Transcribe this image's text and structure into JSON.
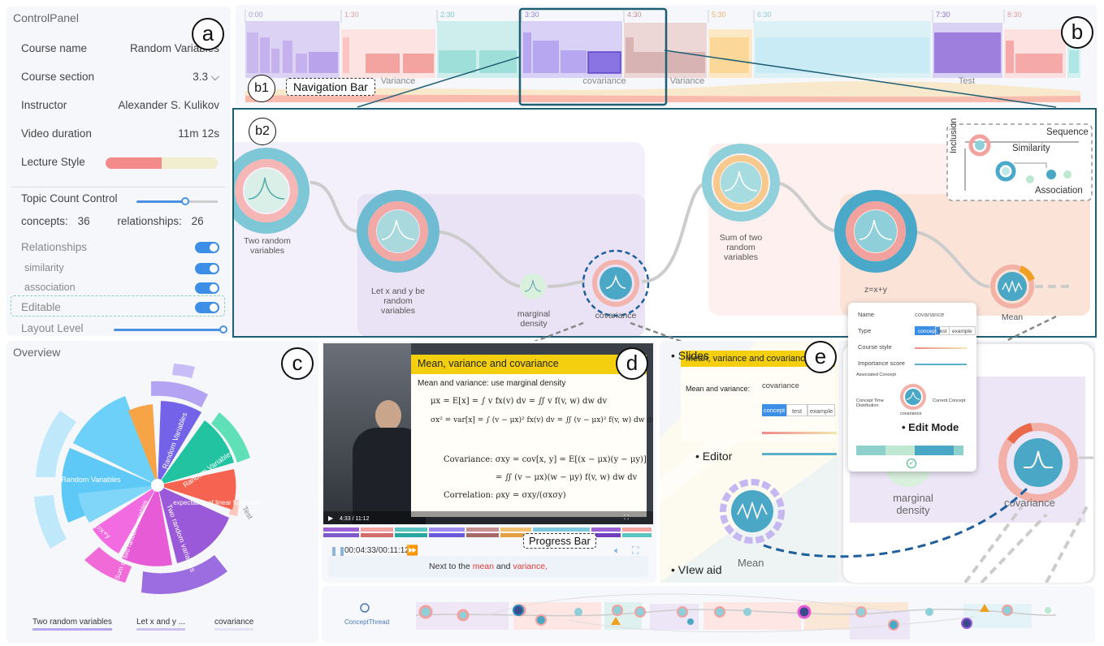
{
  "control_panel": {
    "title": "ControlPanel",
    "course_name_label": "Course name",
    "course_name_value": "Random Variables",
    "course_section_label": "Course section",
    "course_section_value": "3.3",
    "instructor_label": "Instructor",
    "instructor_value": "Alexander S. Kulikov",
    "duration_label": "Video duration",
    "duration_value": "11m 12s",
    "lecture_style_label": "Lecture Style",
    "topic_count_label": "Topic Count Control",
    "concepts_label": "concepts:",
    "concepts_value": "36",
    "relationships_count_label": "relationships:",
    "relationships_count_value": "26",
    "relationships_label": "Relationships",
    "similarity_label": "similarity",
    "association_label": "association",
    "editable_label": "Editable",
    "layout_label": "Layout Level"
  },
  "badges": {
    "a": "a",
    "b": "b",
    "b1": "b1",
    "b2": "b2",
    "c": "c",
    "d": "d",
    "e": "e"
  },
  "navbar": {
    "ticks": [
      "0:00",
      "1:30",
      "2:30",
      "3:30",
      "4:30",
      "5:30",
      "6:30",
      "7:30",
      "8:30"
    ],
    "labels": [
      "Variance",
      "covariance",
      "Variance",
      "Test"
    ],
    "navigation_label": "Navigation Bar"
  },
  "graph": {
    "nodes": [
      "Two random variables",
      "Let x and y be random variables",
      "marginal density",
      "covariance",
      "Sum of two random variables",
      "z=x+y",
      "Mean"
    ],
    "legend": {
      "sequence": "Sequence",
      "similarity": "Similarity",
      "inclusion": "Inclusion",
      "association": "Association"
    }
  },
  "overview": {
    "title": "Overview",
    "segments": [
      "Random Variables",
      "Random Variables",
      "Random Variables",
      "expectation of linear functions",
      "Test",
      "Two random variables",
      "Sum of two random variables",
      "z=x+y"
    ],
    "breadcrumbs": [
      "Two random variables",
      "Let x and y ...",
      "covariance"
    ]
  },
  "video": {
    "slide_title": "Mean, variance and covariance",
    "slide_subtitle": "Mean and variance: use marginal density",
    "formula1": "μx = E[x] = ∫ v fx(v) dv = ∬ v f(v, w) dw dv",
    "formula2": "σx² = var[x] = ∫ (v − μx)² fx(v) dv = ∬ (v − μx)² f(v, w) dw dv",
    "formula3": "Covariance: σxy = cov[x, y] = E[(x − μx)(y − μy)]",
    "formula4": "= ∬ (v − μx)(w − μy) f(v, w) dw dv",
    "formula5": "Correlation: ρxy = σxy/(σxσy)",
    "time_small": "4:33 / 11:12",
    "time": "00:04:33/00:11:12",
    "progress_label": "Progress Bar",
    "caption_prefix": "Next to the",
    "caption_w1": "mean",
    "caption_mid": "and",
    "caption_w2": "variance,"
  },
  "view_aid": {
    "slides_label": "• Slides",
    "editor_label": "• Editor",
    "view_aid_label": "• VIew aid",
    "slide_title": "Mean, variance and covariance",
    "slide_subtitle": "Mean and variance:",
    "covariance_label": "covariance",
    "type_chips": [
      "concept",
      "test",
      "example"
    ],
    "mean_label": "Mean"
  },
  "edit_mode": {
    "name_label": "Name",
    "name_value": "covariance",
    "type_label": "Type",
    "type_chips": [
      "concept",
      "test",
      "example"
    ],
    "course_style_label": "Course style",
    "importance_label": "Importance score",
    "associated_label": "Associated Concept",
    "time_dist_label": "Concept Time Distribution",
    "current_label": "Current Concept",
    "node_label": "covariance",
    "title": "• Edit Mode"
  },
  "zoom": {
    "marginal": "marginal density",
    "covariance": "covariance"
  },
  "concept_thread": {
    "label": "ConceptThread"
  }
}
